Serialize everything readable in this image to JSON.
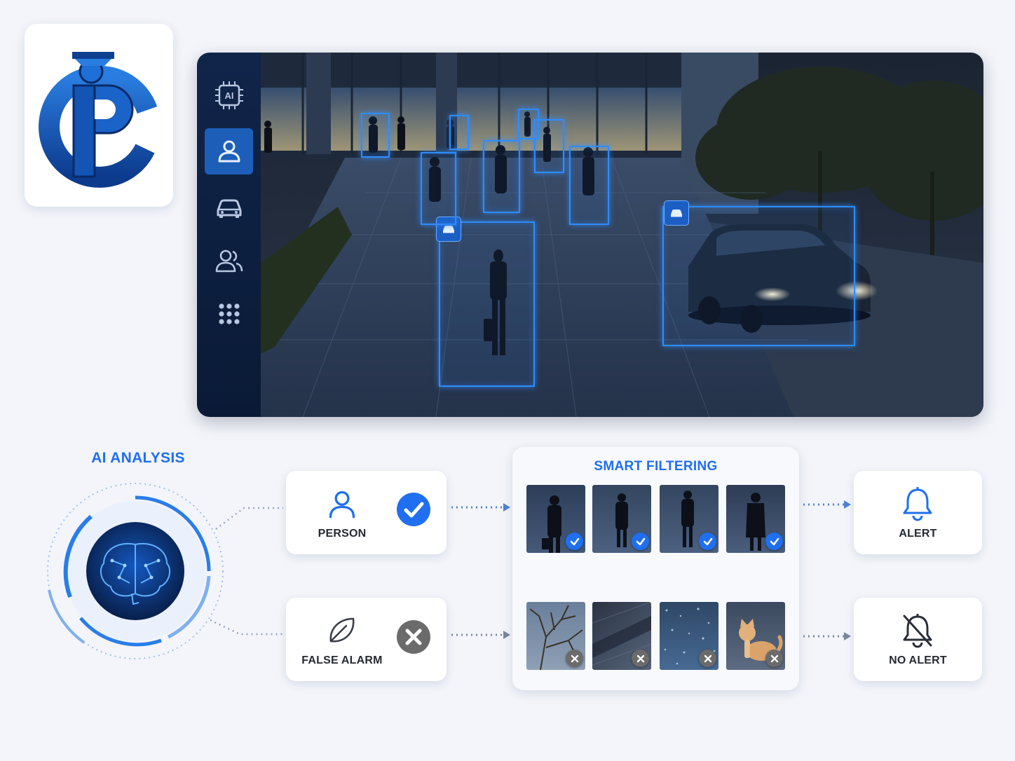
{
  "colors": {
    "accent": "#1f6ff0",
    "sidebar": "#0f2347",
    "detection": "#2f8cff",
    "reject": "#6b6b6b"
  },
  "logo": {
    "icon": "pc-guard-logo-icon"
  },
  "sidebar": {
    "items": [
      {
        "icon": "ai-chip-icon",
        "label": "AI",
        "active": false
      },
      {
        "icon": "person-icon",
        "active": true
      },
      {
        "icon": "car-icon",
        "active": false
      },
      {
        "icon": "group-icon",
        "active": false
      },
      {
        "icon": "grid-menu-icon",
        "active": false
      }
    ]
  },
  "ai_analysis": {
    "title": "AI ANALYSIS",
    "icon": "brain-icon"
  },
  "person_card": {
    "label": "PERSON",
    "icon": "person-icon",
    "status_icon": "check-icon"
  },
  "false_alarm_card": {
    "label": "FALSE ALARM",
    "icon": "leaf-icon",
    "status_icon": "x-icon"
  },
  "smart_filtering": {
    "title": "SMART FILTERING",
    "accepted": [
      {
        "subject": "man-with-briefcase",
        "status": "check-icon"
      },
      {
        "subject": "man-in-suit",
        "status": "check-icon"
      },
      {
        "subject": "woman-walking",
        "status": "check-icon"
      },
      {
        "subject": "woman-in-coat",
        "status": "check-icon"
      }
    ],
    "rejected": [
      {
        "subject": "tree-branches",
        "status": "x-icon"
      },
      {
        "subject": "shadow-on-pavement",
        "status": "x-icon"
      },
      {
        "subject": "rain-drops",
        "status": "x-icon"
      },
      {
        "subject": "cat",
        "status": "x-icon"
      }
    ]
  },
  "alert_card": {
    "label": "ALERT",
    "icon": "bell-icon"
  },
  "no_alert_card": {
    "label": "NO ALERT",
    "icon": "bell-off-icon"
  }
}
